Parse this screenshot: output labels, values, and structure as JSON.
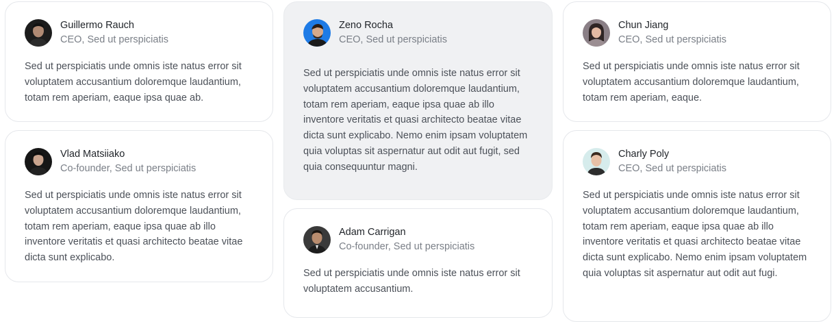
{
  "testimonials": [
    {
      "name": "Guillermo Rauch",
      "role": "CEO, Sed ut perspiciatis",
      "quote": "Sed ut perspiciatis unde omnis iste natus error sit voluptatem accusantium doloremque laudantium, totam rem aperiam, eaque ipsa quae ab."
    },
    {
      "name": "Vlad Matsiiako",
      "role": "Co-founder, Sed ut perspiciatis",
      "quote": "Sed ut perspiciatis unde omnis iste natus error sit voluptatem accusantium doloremque laudantium, totam rem aperiam, eaque ipsa quae ab illo inventore veritatis et quasi architecto beatae vitae dicta sunt explicabo."
    },
    {
      "name": "Zeno Rocha",
      "role": "CEO, Sed ut perspiciatis",
      "quote": "Sed ut perspiciatis unde omnis iste natus error sit voluptatem accusantium doloremque laudantium, totam rem aperiam, eaque ipsa quae ab illo inventore veritatis et quasi architecto beatae vitae dicta sunt explicabo. Nemo enim ipsam voluptatem quia voluptas sit aspernatur aut odit aut fugit, sed quia consequuntur magni."
    },
    {
      "name": "Adam Carrigan",
      "role": "Co-founder, Sed ut perspiciatis",
      "quote": "Sed ut perspiciatis unde omnis iste natus error sit voluptatem accusantium."
    },
    {
      "name": "Chun Jiang",
      "role": "CEO, Sed ut perspiciatis",
      "quote": "Sed ut perspiciatis unde omnis iste natus error sit voluptatem accusantium doloremque laudantium, totam rem aperiam, eaque."
    },
    {
      "name": "Charly Poly",
      "role": "CEO, Sed ut perspiciatis",
      "quote": "Sed ut perspiciatis unde omnis iste natus error sit voluptatem accusantium doloremque laudantium, totam rem aperiam, eaque ipsa quae ab illo inventore veritatis et quasi architecto beatae vitae dicta sunt explicabo. Nemo enim ipsam voluptatem quia voluptas sit aspernatur aut odit aut fugi."
    }
  ]
}
